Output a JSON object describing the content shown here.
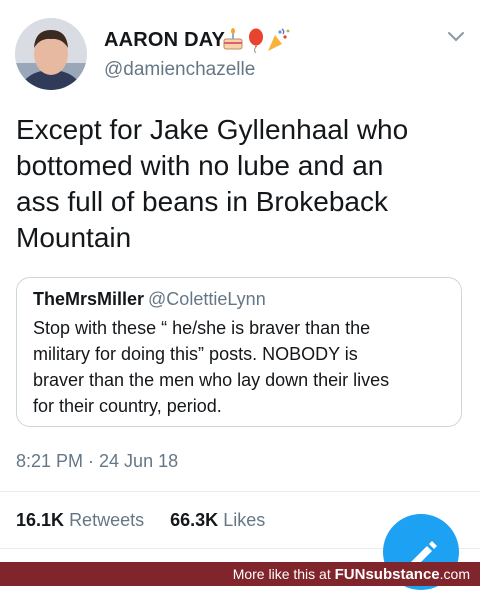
{
  "tweet": {
    "display_name": "AARON DAY",
    "emojis": [
      "birthday-cake-icon",
      "balloon-icon",
      "party-popper-icon"
    ],
    "handle": "@damienchazelle",
    "text": "Except for Jake Gyllenhaal who\nbottomed with no lube and an\nass full of beans in Brokeback\nMountain",
    "timestamp": "8:21 PM · 24 Jun 18"
  },
  "quoted_tweet": {
    "name": "TheMrsMiller",
    "handle": "@ColettieLynn",
    "text": "Stop with these “ he/she is braver than the\nmilitary for doing this” posts. NOBODY is\nbraver than the men who lay down their lives\nfor their country, period."
  },
  "stats": {
    "retweets_count": "16.1K",
    "retweets_label": "Retweets",
    "likes_count": "66.3K",
    "likes_label": "Likes"
  },
  "banner": {
    "text": "More like this at",
    "brand": "FUNsubstance",
    "domain": ".com"
  },
  "colors": {
    "accent": "#1da1f2",
    "banner": "#80252b",
    "secondary_text": "#657786"
  }
}
